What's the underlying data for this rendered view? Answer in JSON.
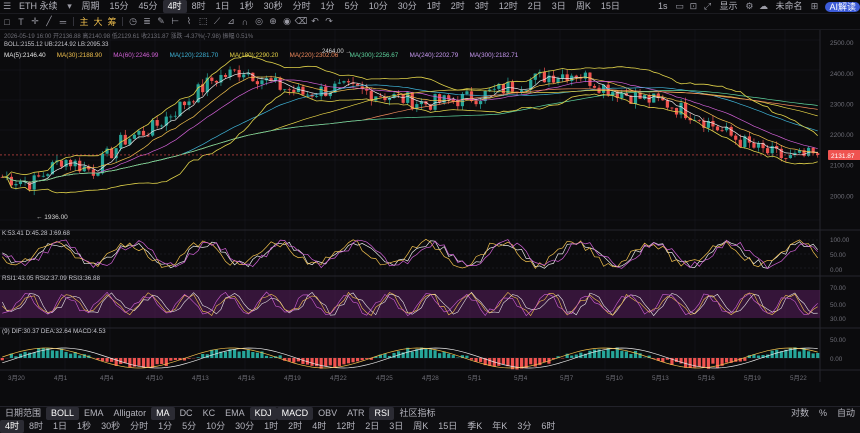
{
  "topbar": {
    "symbol": "ETH 永续",
    "period_label": "周期",
    "timeframes": [
      "15分",
      "45分",
      "4时",
      "8时",
      "1日",
      "1秒",
      "30秒",
      "分时",
      "1分",
      "5分",
      "10分",
      "30分",
      "1时",
      "2时",
      "3时",
      "12时",
      "2日",
      "3日",
      "周K",
      "15日"
    ],
    "active_timeframe": "4时",
    "right": {
      "interval": "1s",
      "display": "显示",
      "user": "未命名",
      "ai": "AI解读"
    }
  },
  "legend": {
    "price_row": "2026-05-19 16:00  开2136.88  高2140.98  低2129.61  收2131.87  涨跌 -4.37%(-7.98)  振幅 0.51%",
    "boll": "BOLL:2155.12  UB:2214.92  LB:2095.33",
    "ma_items": [
      {
        "text": "MA(5):2146.40",
        "color": "#e8e8e8"
      },
      {
        "text": "MA(30):2188.90",
        "color": "#f2c14e"
      },
      {
        "text": "MA(60):2246.99",
        "color": "#d160d6"
      },
      {
        "text": "MA(120):2281.70",
        "color": "#3fb4d8"
      },
      {
        "text": "MA(180):2290.20",
        "color": "#e8d548"
      },
      {
        "text": "MA(220):2302.06",
        "color": "#f08a5d"
      },
      {
        "text": "MA(300):2256.67",
        "color": "#5fd6a0"
      },
      {
        "text": "MA(240):2202.79",
        "color": "#c99af2"
      },
      {
        "text": "MA(300):2182.71",
        "color": "#c99af2"
      }
    ]
  },
  "price_axis": [
    "2500.00",
    "2400.00",
    "2300.00",
    "2200.00",
    "2100.00",
    "2000.00"
  ],
  "current_price": "2131.87",
  "low_marker": "1936.00",
  "high_marker": "2464.00",
  "kdj": {
    "label": "K:53.41  D:45.28  J:69.68",
    "axis": [
      "100.00",
      "50.00",
      "0.00"
    ]
  },
  "rsi": {
    "label": "RSI1:43.05  RSI2:37.09  RSI3:36.88",
    "axis": [
      "70.00",
      "50.00",
      "30.00"
    ]
  },
  "macd": {
    "label": "(9) DIF:30.37  DEA:32.64  MACD:4.53",
    "axis": [
      "50.00",
      "0.00"
    ]
  },
  "date_axis": [
    "3月20",
    "4月1",
    "4月4",
    "4月10",
    "4月13",
    "4月16",
    "4月19",
    "4月22",
    "4月25",
    "4月28",
    "5月1",
    "5月4",
    "5月7",
    "5月10",
    "5月13",
    "5月16",
    "5月19",
    "5月22"
  ],
  "indbar": {
    "left": [
      "日期范围",
      "BOLL",
      "EMA",
      "Alligator",
      "MA",
      "DC",
      "KC",
      "EMA",
      "KDJ",
      "MACD",
      "OBV",
      "ATR",
      "RSI",
      "社区指标"
    ],
    "selected": [
      "BOLL",
      "MA",
      "KDJ",
      "MACD",
      "RSI"
    ],
    "right": [
      "对数",
      "%",
      "自动"
    ]
  },
  "tfbar": [
    "4时",
    "8时",
    "1日",
    "1秒",
    "30秒",
    "分时",
    "1分",
    "5分",
    "10分",
    "30分",
    "1时",
    "2时",
    "4时",
    "12时",
    "2日",
    "3日",
    "周K",
    "15日",
    "季K",
    "年K",
    "3分",
    "6时"
  ],
  "tfbar_selected": "4时",
  "colors": {
    "up": "#26a69a",
    "down": "#ef5350",
    "bg": "#0b0b0d",
    "grid": "#1a1a20"
  },
  "chart_data": {
    "type": "candlestick",
    "seed": 7,
    "count": 180,
    "start": 2060,
    "path": [
      2060,
      2040,
      2120,
      2080,
      2180,
      2220,
      2300,
      2380,
      2410,
      2360,
      2330,
      2350,
      2340,
      2320,
      2300,
      2310,
      2330,
      2360,
      2390,
      2400,
      2350,
      2320,
      2300,
      2260,
      2200,
      2150,
      2120,
      2131.87
    ],
    "ylim": [
      1900,
      2520
    ]
  }
}
